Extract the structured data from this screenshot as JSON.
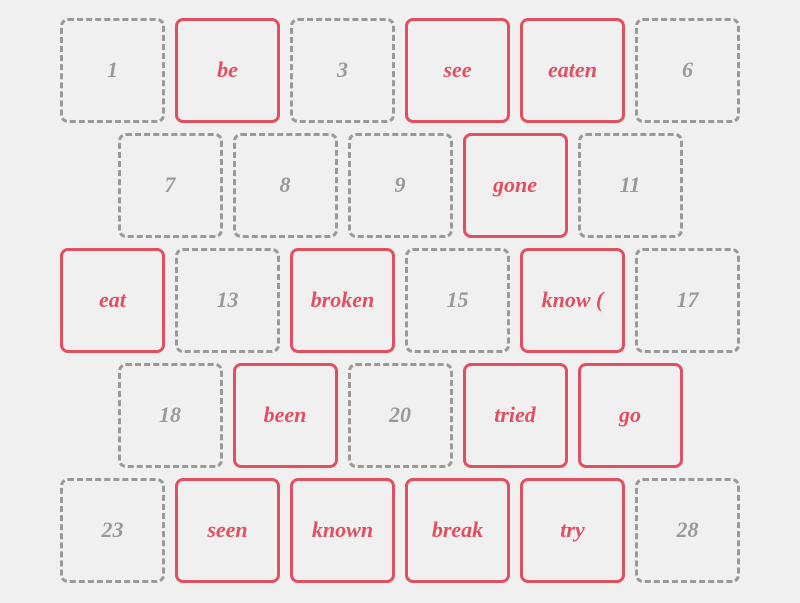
{
  "rows": [
    [
      {
        "label": "1",
        "style": "gray"
      },
      {
        "label": "be",
        "style": "red"
      },
      {
        "label": "3",
        "style": "gray"
      },
      {
        "label": "see",
        "style": "red"
      },
      {
        "label": "eaten",
        "style": "red"
      },
      {
        "label": "6",
        "style": "gray"
      }
    ],
    [
      {
        "label": "7",
        "style": "gray"
      },
      {
        "label": "8",
        "style": "gray"
      },
      {
        "label": "9",
        "style": "gray"
      },
      {
        "label": "gone",
        "style": "red"
      },
      {
        "label": "11",
        "style": "gray"
      }
    ],
    [
      {
        "label": "eat",
        "style": "red"
      },
      {
        "label": "13",
        "style": "gray"
      },
      {
        "label": "broken",
        "style": "red"
      },
      {
        "label": "15",
        "style": "gray"
      },
      {
        "label": "know (",
        "style": "red"
      },
      {
        "label": "17",
        "style": "gray"
      }
    ],
    [
      {
        "label": "18",
        "style": "gray"
      },
      {
        "label": "been",
        "style": "red"
      },
      {
        "label": "20",
        "style": "gray"
      },
      {
        "label": "tried",
        "style": "red"
      },
      {
        "label": "go",
        "style": "red"
      }
    ],
    [
      {
        "label": "23",
        "style": "gray"
      },
      {
        "label": "seen",
        "style": "red"
      },
      {
        "label": "known",
        "style": "red"
      },
      {
        "label": "break",
        "style": "red"
      },
      {
        "label": "try",
        "style": "red"
      },
      {
        "label": "28",
        "style": "gray"
      }
    ]
  ]
}
